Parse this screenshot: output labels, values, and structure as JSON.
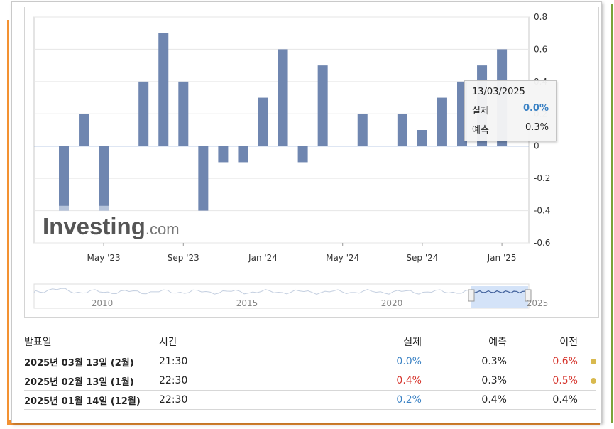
{
  "chart_data": {
    "type": "bar",
    "categories": [
      "Mar '23",
      "Apr '23",
      "May '23",
      "Jun '23",
      "Jul '23",
      "Aug '23",
      "Sep '23",
      "Oct '23",
      "Nov '23",
      "Dec '23",
      "Jan '24",
      "Feb '24",
      "Mar '24",
      "Apr '24",
      "May '24",
      "Jun '24",
      "Jul '24",
      "Aug '24",
      "Sep '24",
      "Oct '24",
      "Nov '24",
      "Dec '24",
      "Jan '25",
      "Feb '25",
      "Mar '25"
    ],
    "values": [
      -0.4,
      0.2,
      -0.4,
      0.0,
      0.4,
      0.7,
      0.4,
      -0.4,
      -0.1,
      -0.1,
      0.3,
      0.6,
      -0.1,
      0.5,
      0.0,
      0.2,
      0.0,
      0.2,
      0.1,
      0.3,
      0.4,
      0.5,
      0.6,
      0.0
    ],
    "forecast_overlay": [
      -0.37,
      null,
      -0.37,
      null,
      null,
      null,
      null,
      null,
      null,
      null,
      null,
      null,
      null,
      null,
      null,
      null,
      null,
      null,
      null,
      null,
      null,
      null,
      null,
      null
    ],
    "x_tick_labels": [
      "May '23",
      "Sep '23",
      "Jan '24",
      "May '24",
      "Sep '24",
      "Jan '25"
    ],
    "y_tick_labels": [
      "0.8",
      "0.6",
      "0.4",
      "0.2",
      "0",
      "-0.2",
      "-0.4",
      "-0.6"
    ],
    "ylim": [
      -0.6,
      0.8
    ],
    "bar_color": "#6f86b0",
    "overlay_color": "#b5c3da",
    "navigator_labels": [
      "2010",
      "2015",
      "2020",
      "2025"
    ],
    "watermark": "Investing.com",
    "grid": true
  },
  "tooltip": {
    "date": "13/03/2025",
    "actual_label": "실제",
    "actual_value": "0.0%",
    "forecast_label": "예측",
    "forecast_value": "0.3%"
  },
  "table": {
    "headers": [
      "발표일",
      "시간",
      "실제",
      "예측",
      "이전"
    ],
    "rows": [
      {
        "date": "2025년 03월 13일 (2월)",
        "time": "21:30",
        "actual": "0.0%",
        "actual_color": "blue",
        "forecast": "0.3%",
        "previous": "0.6%",
        "previous_color": "red",
        "dot": true
      },
      {
        "date": "2025년 02월 13일 (1월)",
        "time": "22:30",
        "actual": "0.4%",
        "actual_color": "red",
        "forecast": "0.3%",
        "previous": "0.5%",
        "previous_color": "red",
        "dot": true
      },
      {
        "date": "2025년 01월 14일 (12월)",
        "time": "22:30",
        "actual": "0.2%",
        "actual_color": "blue",
        "forecast": "0.4%",
        "previous": "0.4%",
        "previous_color": "black",
        "dot": false
      }
    ]
  }
}
